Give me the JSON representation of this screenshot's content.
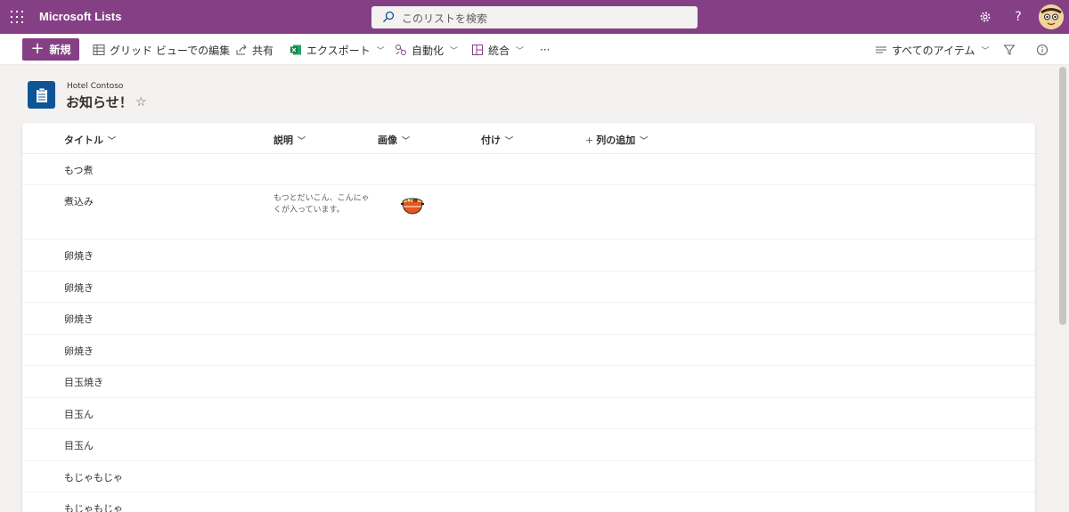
{
  "app": {
    "title": "Microsoft Lists"
  },
  "search": {
    "placeholder": "このリストを検索"
  },
  "colors": {
    "brand": "#854085",
    "list_icon": "#0f5496"
  },
  "toolbar": {
    "new_label": "新規",
    "grid_edit": "グリッド ビューでの編集",
    "share": "共有",
    "export": "エクスポート",
    "automate": "自動化",
    "integrate": "統合",
    "more": "···",
    "view_name": "すべてのアイテム"
  },
  "list": {
    "site": "Hotel Contoso",
    "name": "お知らせ！"
  },
  "columns": {
    "title": "タイトル",
    "description": "説明",
    "image": "画像",
    "attached": "付け",
    "add_column": "列の追加"
  },
  "rows": [
    {
      "title": "もつ煮"
    },
    {
      "title": "煮込み",
      "description": "もつとだいこん、こんにゃくが入っています。",
      "image": "oden-pot-icon"
    },
    {
      "title": "卵焼き"
    },
    {
      "title": "卵焼き"
    },
    {
      "title": "卵焼き"
    },
    {
      "title": "卵焼き"
    },
    {
      "title": "目玉焼き"
    },
    {
      "title": "目玉ん"
    },
    {
      "title": "目玉ん"
    },
    {
      "title": "もじゃもじゃ"
    },
    {
      "title": "もじゃもじゃ"
    }
  ]
}
